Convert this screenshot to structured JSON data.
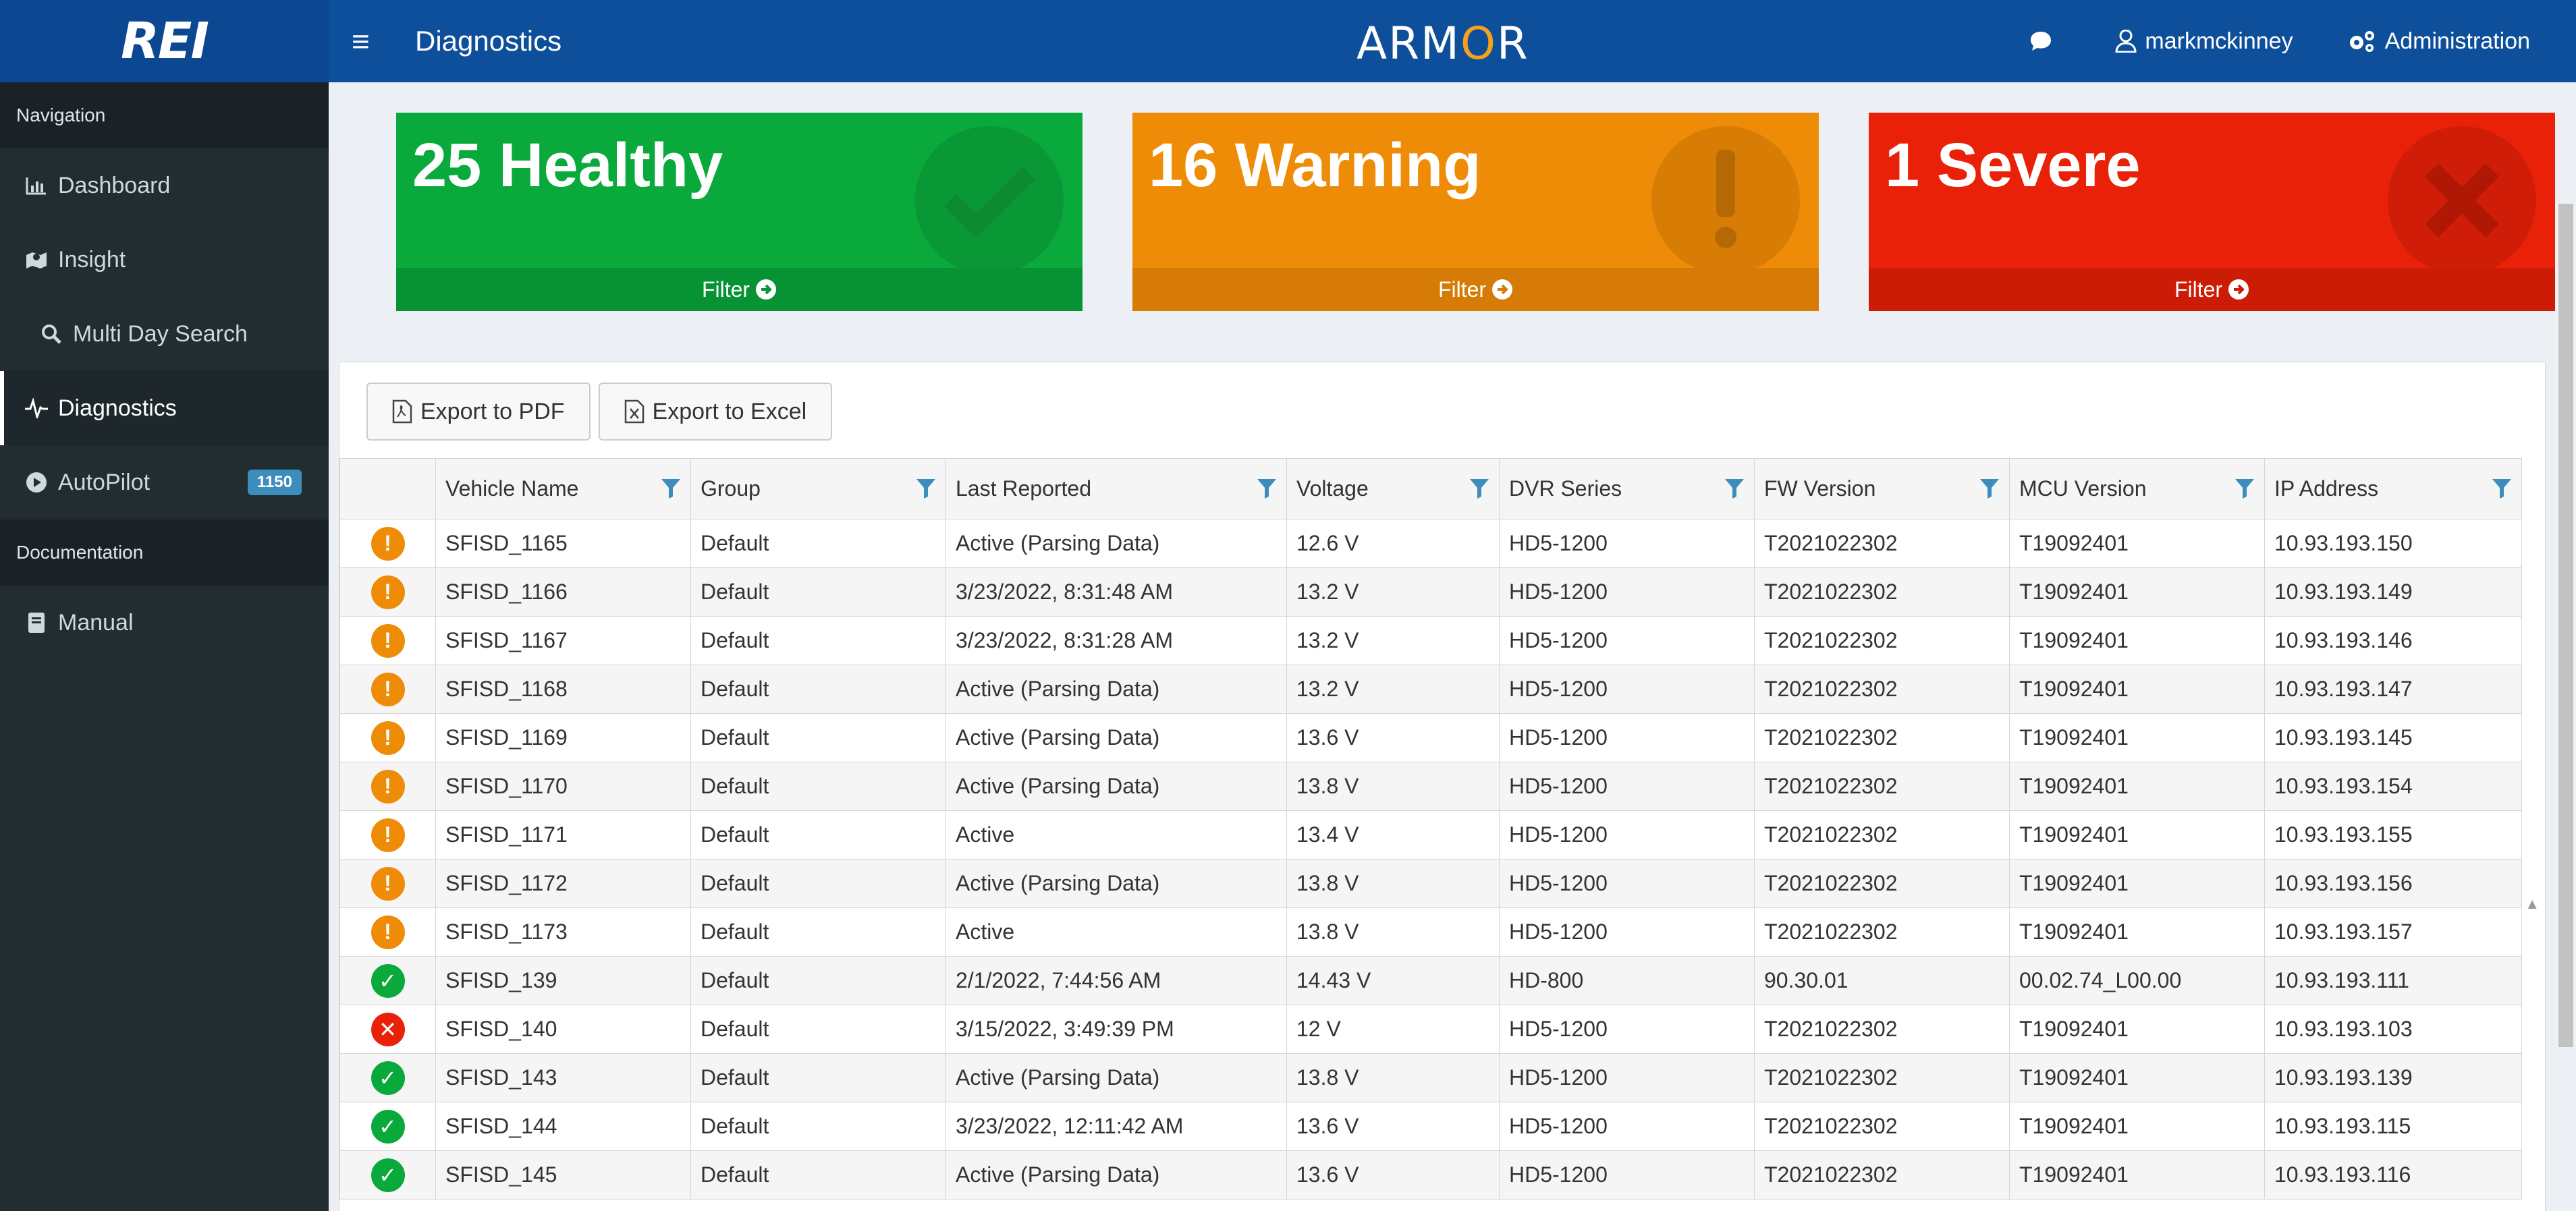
{
  "header": {
    "logo": "REI",
    "page_title": "Diagnostics",
    "brand_left": "ARM",
    "brand_o": "O",
    "brand_right": "R",
    "user": "markmckinney",
    "admin": "Administration"
  },
  "sidebar": {
    "navigation_label": "Navigation",
    "documentation_label": "Documentation",
    "items": [
      {
        "label": "Dashboard"
      },
      {
        "label": "Insight"
      },
      {
        "label": "Multi Day Search"
      },
      {
        "label": "Diagnostics"
      },
      {
        "label": "AutoPilot",
        "badge": "1150"
      },
      {
        "label": "Manual"
      }
    ]
  },
  "cards": {
    "healthy": {
      "count": "25 Healthy",
      "filter": "Filter"
    },
    "warning": {
      "count": "16 Warning",
      "filter": "Filter"
    },
    "severe": {
      "count": "1 Severe",
      "filter": "Filter"
    }
  },
  "toolbar": {
    "export_pdf": "Export to PDF",
    "export_excel": "Export to Excel"
  },
  "table": {
    "columns": [
      "Vehicle Name",
      "Group",
      "Last Reported",
      "Voltage",
      "DVR Series",
      "FW Version",
      "MCU Version",
      "IP Address"
    ],
    "rows": [
      {
        "status": "warning",
        "vehicle": "SFISD_1165",
        "group": "Default",
        "last": "Active (Parsing Data)",
        "voltage": "12.6 V",
        "dvr": "HD5-1200",
        "fw": "T2021022302",
        "mcu": "T19092401",
        "ip": "10.93.193.150"
      },
      {
        "status": "warning",
        "vehicle": "SFISD_1166",
        "group": "Default",
        "last": "3/23/2022, 8:31:48 AM",
        "voltage": "13.2 V",
        "dvr": "HD5-1200",
        "fw": "T2021022302",
        "mcu": "T19092401",
        "ip": "10.93.193.149"
      },
      {
        "status": "warning",
        "vehicle": "SFISD_1167",
        "group": "Default",
        "last": "3/23/2022, 8:31:28 AM",
        "voltage": "13.2 V",
        "dvr": "HD5-1200",
        "fw": "T2021022302",
        "mcu": "T19092401",
        "ip": "10.93.193.146"
      },
      {
        "status": "warning",
        "vehicle": "SFISD_1168",
        "group": "Default",
        "last": "Active (Parsing Data)",
        "voltage": "13.2 V",
        "dvr": "HD5-1200",
        "fw": "T2021022302",
        "mcu": "T19092401",
        "ip": "10.93.193.147"
      },
      {
        "status": "warning",
        "vehicle": "SFISD_1169",
        "group": "Default",
        "last": "Active (Parsing Data)",
        "voltage": "13.6 V",
        "dvr": "HD5-1200",
        "fw": "T2021022302",
        "mcu": "T19092401",
        "ip": "10.93.193.145"
      },
      {
        "status": "warning",
        "vehicle": "SFISD_1170",
        "group": "Default",
        "last": "Active (Parsing Data)",
        "voltage": "13.8 V",
        "dvr": "HD5-1200",
        "fw": "T2021022302",
        "mcu": "T19092401",
        "ip": "10.93.193.154"
      },
      {
        "status": "warning",
        "vehicle": "SFISD_1171",
        "group": "Default",
        "last": "Active",
        "voltage": "13.4 V",
        "dvr": "HD5-1200",
        "fw": "T2021022302",
        "mcu": "T19092401",
        "ip": "10.93.193.155"
      },
      {
        "status": "warning",
        "vehicle": "SFISD_1172",
        "group": "Default",
        "last": "Active (Parsing Data)",
        "voltage": "13.8 V",
        "dvr": "HD5-1200",
        "fw": "T2021022302",
        "mcu": "T19092401",
        "ip": "10.93.193.156"
      },
      {
        "status": "warning",
        "vehicle": "SFISD_1173",
        "group": "Default",
        "last": "Active",
        "voltage": "13.8 V",
        "dvr": "HD5-1200",
        "fw": "T2021022302",
        "mcu": "T19092401",
        "ip": "10.93.193.157"
      },
      {
        "status": "healthy",
        "vehicle": "SFISD_139",
        "group": "Default",
        "last": "2/1/2022, 7:44:56 AM",
        "voltage": "14.43 V",
        "dvr": "HD-800",
        "fw": "90.30.01",
        "mcu": "00.02.74_L00.00",
        "ip": "10.93.193.111"
      },
      {
        "status": "severe",
        "vehicle": "SFISD_140",
        "group": "Default",
        "last": "3/15/2022, 3:49:39 PM",
        "voltage": "12 V",
        "dvr": "HD5-1200",
        "fw": "T2021022302",
        "mcu": "T19092401",
        "ip": "10.93.193.103"
      },
      {
        "status": "healthy",
        "vehicle": "SFISD_143",
        "group": "Default",
        "last": "Active (Parsing Data)",
        "voltage": "13.8 V",
        "dvr": "HD5-1200",
        "fw": "T2021022302",
        "mcu": "T19092401",
        "ip": "10.93.193.139"
      },
      {
        "status": "healthy",
        "vehicle": "SFISD_144",
        "group": "Default",
        "last": "3/23/2022, 12:11:42 AM",
        "voltage": "13.6 V",
        "dvr": "HD5-1200",
        "fw": "T2021022302",
        "mcu": "T19092401",
        "ip": "10.93.193.115"
      },
      {
        "status": "healthy",
        "vehicle": "SFISD_145",
        "group": "Default",
        "last": "Active (Parsing Data)",
        "voltage": "13.6 V",
        "dvr": "HD5-1200",
        "fw": "T2021022302",
        "mcu": "T19092401",
        "ip": "10.93.193.116"
      }
    ]
  },
  "colors": {
    "header": "#0e4f9c",
    "sidebar": "#222d32",
    "healthy": "#0aa93b",
    "warning": "#ef8c07",
    "severe": "#e92108",
    "filter_icon": "#3c8dbc"
  },
  "icons": {
    "status_healthy": "check-circle-icon",
    "status_warning": "exclamation-circle-icon",
    "status_severe": "x-circle-icon",
    "column_filter": "funnel-icon"
  }
}
